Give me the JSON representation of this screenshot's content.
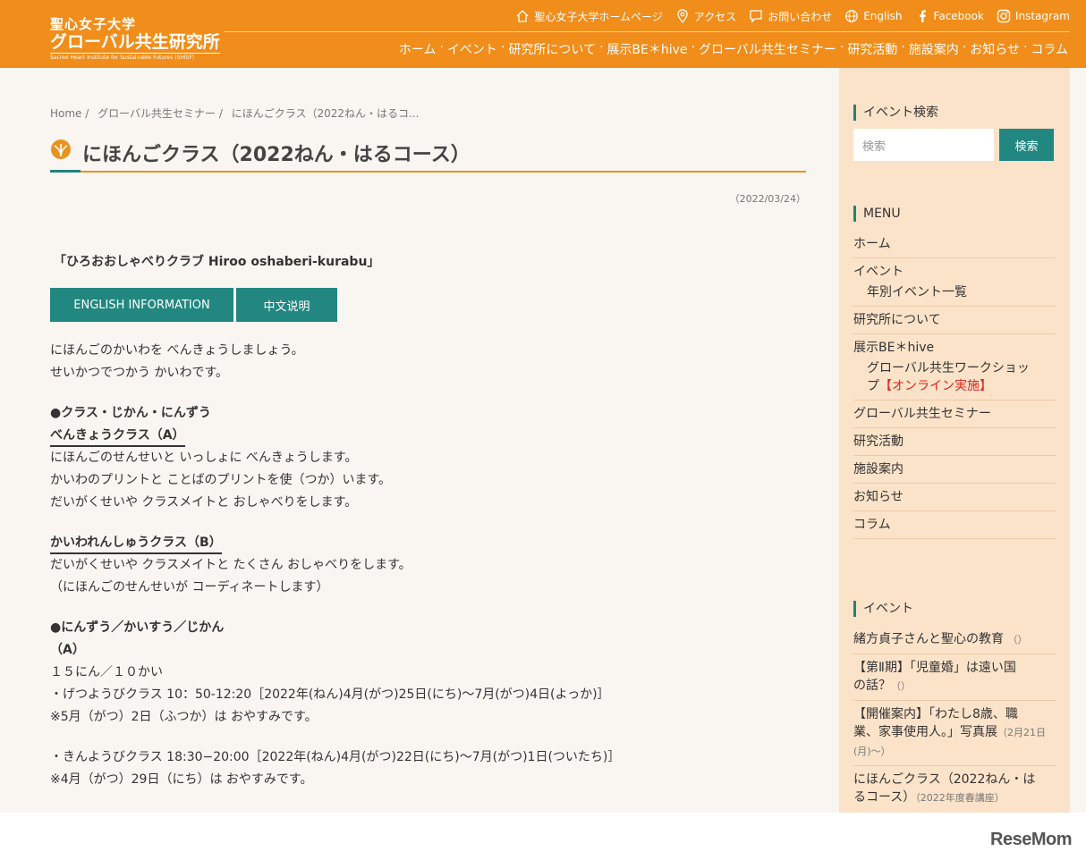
{
  "header": {
    "logo_line1": "聖心女子大学",
    "logo_line2": "グローバル共生研究所",
    "logo_line3": "Sacred Heart Institute for Sustainable Futures (SHISF)",
    "top_links": [
      {
        "label": "聖心女子大学ホームページ",
        "icon": "home-icon"
      },
      {
        "label": "アクセス",
        "icon": "map-pin-icon"
      },
      {
        "label": "お問い合わせ",
        "icon": "chat-icon"
      },
      {
        "label": "English",
        "icon": "globe-icon"
      },
      {
        "label": "Facebook",
        "icon": "facebook-icon"
      },
      {
        "label": "Instagram",
        "icon": "instagram-icon"
      }
    ],
    "nav": [
      "ホーム",
      "イベント",
      "研究所について",
      "展示BE＊hive",
      "グローバル共生セミナー",
      "研究活動",
      "施設案内",
      "お知らせ",
      "コラム"
    ]
  },
  "breadcrumb": [
    "Home",
    "/",
    "グローバル共生セミナー",
    "/",
    "にほんごクラス（2022ねん・はるコ..."
  ],
  "page": {
    "title": "にほんごクラス（2022ねん・はるコース）",
    "date": "（2022/03/24）",
    "subtitle": "「ひろおおしゃべりクラブ Hiroo oshaberi-kurabu」",
    "btn_english": "ENGLISH INFORMATION",
    "btn_chinese": "中文说明",
    "intro1": "にほんごのかいわを べんきょうしましょう。",
    "intro2": "せいかつでつかう かいわです。",
    "h_class": "●クラス・じかん・にんずう",
    "class_a_title": "べんきょうクラス（A）",
    "class_a_1": "にほんごのせんせいと いっしょに べんきょうします。",
    "class_a_2": "かいわのプリントと ことばのプリントを使（つか）います。",
    "class_a_3": "だいがくせいや クラスメイトと おしゃべりをします。",
    "class_b_title": "かいわれんしゅうクラス（B）",
    "class_b_1": "だいがくせいや クラスメイトと たくさん おしゃべりをします。",
    "class_b_2": "（にほんごのせんせいが コーディネートします）",
    "h_count": "●にんずう／かいすう／じかん",
    "a_label": "（A）",
    "a_count": "１５にん／１０かい",
    "mon_class": "・げつようびクラス 10：50-12:20［2022年(ねん)4月(がつ)25日(にち)〜7月(がつ)4日(よっか)］",
    "mon_note": "※5月（がつ）2日（ふつか）は おやすみです。",
    "fri_class": "・きんようびクラス 18:30−20:00［2022年(ねん)4月(がつ)22日(にち)〜7月(がつ)1日(ついたち)］",
    "fri_note": "※4月（がつ）29日（にち）は おやすみです。"
  },
  "sidebar": {
    "search_title": "イベント検索",
    "search_placeholder": "検索",
    "search_button": "検索",
    "menu_title": "MENU",
    "menu": {
      "home": "ホーム",
      "event": "イベント",
      "event_sub": "年別イベント一覧",
      "about": "研究所について",
      "behive": "展示BE＊hive",
      "behive_sub_a": "グローバル共生ワークショッ",
      "behive_sub_b": "プ",
      "behive_sub_red": "【オンライン実施】",
      "seminar": "グローバル共生セミナー",
      "research": "研究活動",
      "facility": "施設案内",
      "news": "お知らせ",
      "column": "コラム"
    },
    "events_title": "イベント",
    "events": [
      {
        "a": "緒方貞子さんと聖心の教育",
        "b": "",
        "note": "（）"
      },
      {
        "a": "【第Ⅱ期】「児童婚」は遠い国",
        "b": "の話？",
        "note": "（）"
      },
      {
        "a": "【開催案内】「わたし8歳、職",
        "b": "業、家事使用人。」写真展",
        "note": "（2月21日(月)〜）"
      },
      {
        "a": "にほんごクラス（2022ねん・は",
        "b": "るコース）",
        "note": "（2022年度春講座）"
      }
    ]
  },
  "footer": {
    "logo_rese": "Rese",
    "logo_mom": "Mom"
  }
}
